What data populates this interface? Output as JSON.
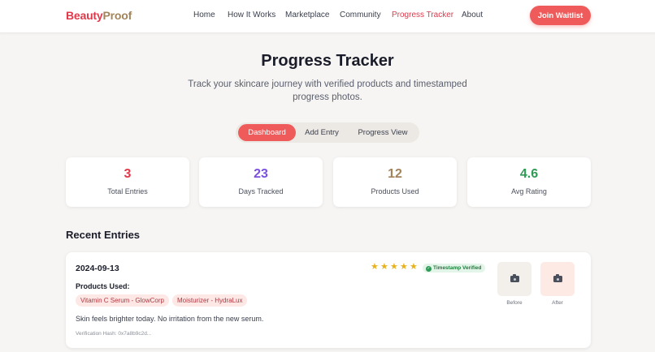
{
  "brand": {
    "name_part1": "Beauty",
    "name_part2": "Proof"
  },
  "nav": {
    "items": [
      {
        "label": "Home",
        "active": false
      },
      {
        "label": "How It Works",
        "active": false
      },
      {
        "label": "Marketplace",
        "active": false
      },
      {
        "label": "Community",
        "active": false
      },
      {
        "label": "Progress Tracker",
        "active": true
      },
      {
        "label": "About",
        "active": false
      }
    ],
    "cta_label": "Join Waitlist"
  },
  "hero": {
    "title": "Progress Tracker",
    "subtitle": "Track your skincare journey with verified products and timestamped progress photos."
  },
  "tabs": [
    {
      "label": "Dashboard",
      "active": true
    },
    {
      "label": "Add Entry",
      "active": false
    },
    {
      "label": "Progress View",
      "active": false
    }
  ],
  "stats": [
    {
      "value": "3",
      "label": "Total Entries",
      "color": "#e0394a"
    },
    {
      "value": "23",
      "label": "Days Tracked",
      "color": "#7b4fe0"
    },
    {
      "value": "12",
      "label": "Products Used",
      "color": "#a3845a"
    },
    {
      "value": "4.6",
      "label": "Avg Rating",
      "color": "#2e9b55"
    }
  ],
  "recent": {
    "title": "Recent Entries",
    "entries": [
      {
        "date": "2024-09-13",
        "products_label": "Products Used:",
        "products": [
          "Vitamin C Serum - GlowCorp",
          "Moisturizer - HydraLux"
        ],
        "note": "Skin feels brighter today. No irritation from the new serum.",
        "hash": "Verification Hash: 0x7a8b9c2d...",
        "rating": 5,
        "verified_label": "Timestamp Verified",
        "before_label": "Before",
        "after_label": "After",
        "photo_icon": "camera-icon"
      }
    ]
  },
  "colors": {
    "accent": "#ef5b5b",
    "brand_red": "#e0394a",
    "brand_gold": "#a3845a",
    "star": "#e8b21c",
    "verified": "#2e9b55",
    "background": "#f7f5f3"
  }
}
